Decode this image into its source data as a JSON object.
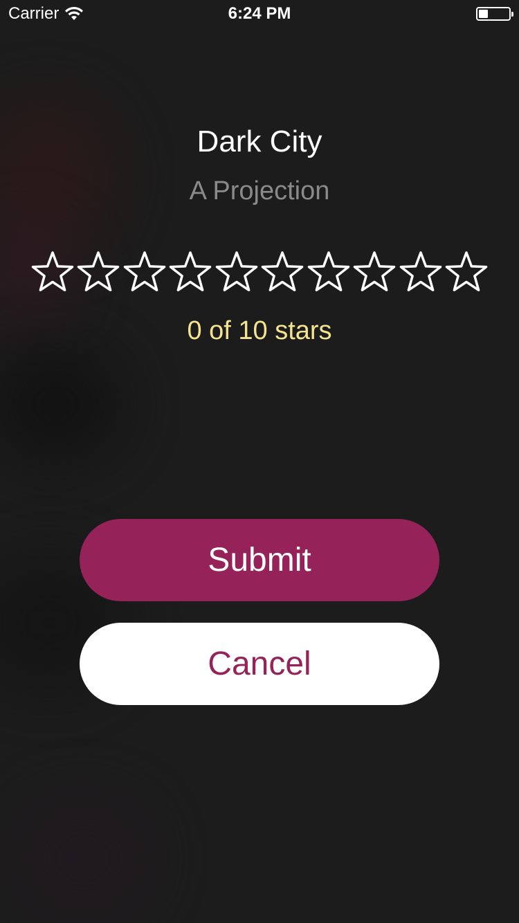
{
  "status_bar": {
    "carrier": "Carrier",
    "time": "6:24 PM",
    "wifi_icon": "wifi-icon",
    "battery_icon": "battery-icon",
    "battery_level": 0.3
  },
  "movie": {
    "title": "Dark City",
    "subtitle": "A Projection"
  },
  "rating": {
    "max_stars": 10,
    "value": 0,
    "star_icon": "star-outline-icon",
    "label": "0 of 10 stars",
    "label_color": "#f5e48f"
  },
  "buttons": {
    "submit_label": "Submit",
    "cancel_label": "Cancel"
  },
  "colors": {
    "accent": "#952259",
    "background": "#1c1c1c",
    "star_outline": "#ffffff"
  }
}
